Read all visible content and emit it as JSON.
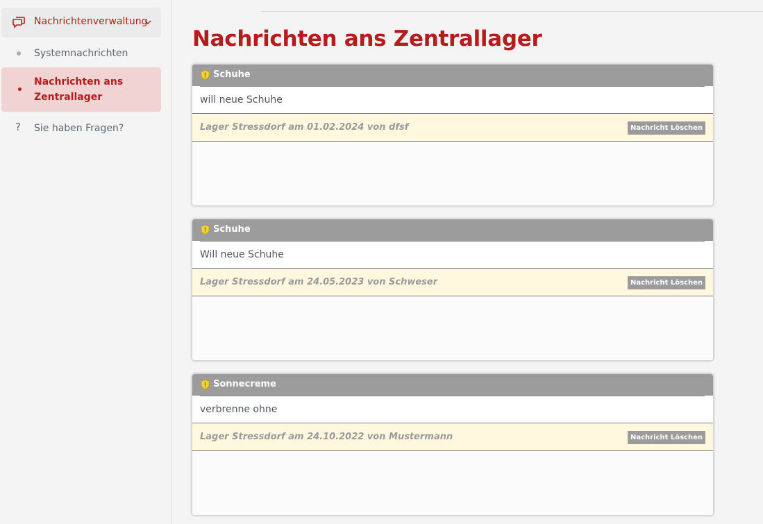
{
  "sidebar": {
    "parent": {
      "label": "Nachrichtenverwaltung",
      "icon": "chat-bubbles-icon"
    },
    "items": [
      {
        "label": "Systemnachrichten"
      },
      {
        "label": "Nachrichten ans Zentrallager"
      }
    ],
    "help": {
      "symbol": "?",
      "label": "Sie haben Fragen?"
    }
  },
  "page": {
    "title": "Nachrichten ans Zentrallager"
  },
  "messages": [
    {
      "subject": "Schuhe",
      "body": "will neue Schuhe",
      "meta": "Lager Stressdorf am 01.02.2024 von dfsf",
      "delete_label": "Nachricht Löschen"
    },
    {
      "subject": "Schuhe",
      "body": "Will neue Schuhe",
      "meta": "Lager Stressdorf am 24.05.2023 von Schweser",
      "delete_label": "Nachricht Löschen"
    },
    {
      "subject": "Sonnecreme",
      "body": "verbrenne ohne",
      "meta": "Lager Stressdorf am 24.10.2022 von Mustermann",
      "delete_label": "Nachricht Löschen"
    }
  ],
  "colors": {
    "accent": "#b71c1c",
    "header": "#9c9c9c",
    "meta_bg": "#fff8df",
    "active_bg": "#f2d3d4"
  }
}
